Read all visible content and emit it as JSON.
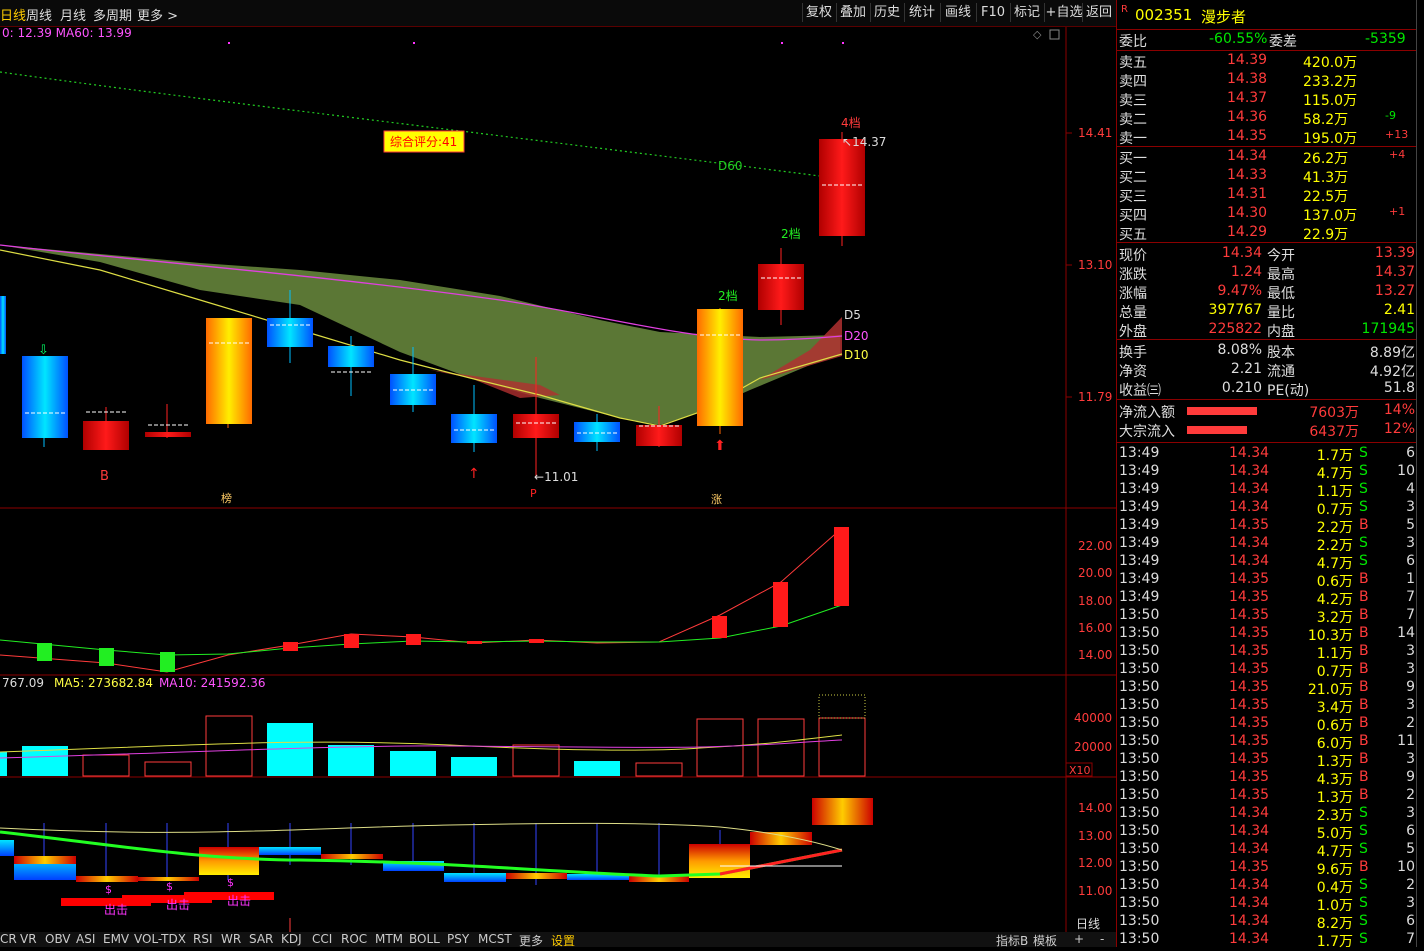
{
  "topbar": {
    "tabs": [
      "日线",
      "周线",
      "月线",
      "多周期",
      "更多 >"
    ],
    "buttons": [
      "复权",
      "叠加",
      "历史",
      "统计",
      "画线",
      "F10",
      "标记",
      "+自选",
      "返回"
    ]
  },
  "main": {
    "ma_text": "0: 12.39  MA60: 13.99",
    "score": "综合评分:41",
    "d60": "D60",
    "d5": "D5",
    "d20": "D20",
    "d10": "D10",
    "price_labels": [
      "14.41",
      "13.10",
      "11.79"
    ],
    "high_mark": "14.37",
    "low_mark": "11.01",
    "tag_4": "4档",
    "tag_2a": "2档",
    "tag_2b": "2档",
    "mark_b": "B",
    "mark_bang": "榜",
    "mark_zhang": "涨"
  },
  "panel2": {
    "axis": [
      "22.00",
      "20.00",
      "18.00",
      "16.00",
      "14.00"
    ]
  },
  "volume": {
    "text_a": "767.09",
    "text_b": "MA5: 273682.84",
    "text_c": "MA10: 241592.36",
    "axis": [
      "40000",
      "20000"
    ],
    "unit": "X10"
  },
  "panel4": {
    "axis": [
      "14.00",
      "13.00",
      "12.00",
      "11.00"
    ],
    "label_chuji": "出击",
    "dollar": "$"
  },
  "bottom": {
    "tabs": [
      "CR",
      "VR",
      "OBV",
      "ASI",
      "EMV",
      "VOL-TDX",
      "RSI",
      "WR",
      "SAR",
      "KDJ",
      "CCI",
      "ROC",
      "MTM",
      "BOLL",
      "PSY",
      "MCST",
      "更多",
      "设置"
    ],
    "right": [
      "指标B",
      "模板",
      "+",
      "-"
    ],
    "period": "日线"
  },
  "quote": {
    "code": "002351",
    "name": "漫步者",
    "r_mark": "R",
    "weibi_label": "委比",
    "weibi": "-60.55%",
    "weicha_label": "委差",
    "weicha": "-5359",
    "sell": [
      {
        "label": "卖五",
        "price": "14.39",
        "vol": "420.0万",
        "chg": ""
      },
      {
        "label": "卖四",
        "price": "14.38",
        "vol": "233.2万",
        "chg": ""
      },
      {
        "label": "卖三",
        "price": "14.37",
        "vol": "115.0万",
        "chg": ""
      },
      {
        "label": "卖二",
        "price": "14.36",
        "vol": "58.2万",
        "chg": "-9"
      },
      {
        "label": "卖一",
        "price": "14.35",
        "vol": "195.0万",
        "chg": "+13"
      }
    ],
    "buy": [
      {
        "label": "买一",
        "price": "14.34",
        "vol": "26.2万",
        "chg": "+4"
      },
      {
        "label": "买二",
        "price": "14.33",
        "vol": "41.3万",
        "chg": ""
      },
      {
        "label": "买三",
        "price": "14.31",
        "vol": "22.5万",
        "chg": ""
      },
      {
        "label": "买四",
        "price": "14.30",
        "vol": "137.0万",
        "chg": "+1"
      },
      {
        "label": "买五",
        "price": "14.29",
        "vol": "22.9万",
        "chg": ""
      }
    ],
    "stats": [
      {
        "l1": "现价",
        "v1": "14.34",
        "l2": "今开",
        "v2": "13.39"
      },
      {
        "l1": "涨跌",
        "v1": "1.24",
        "l2": "最高",
        "v2": "14.37"
      },
      {
        "l1": "涨幅",
        "v1": "9.47%",
        "l2": "最低",
        "v2": "13.27"
      },
      {
        "l1": "总量",
        "v1": "397767",
        "l2": "量比",
        "v2": "2.41"
      },
      {
        "l1": "外盘",
        "v1": "225822",
        "l2": "内盘",
        "v2": "171945"
      }
    ],
    "stats2": [
      {
        "l1": "换手",
        "v1": "8.08%",
        "l2": "股本",
        "v2": "8.89亿"
      },
      {
        "l1": "净资",
        "v1": "2.21",
        "l2": "流通",
        "v2": "4.92亿"
      },
      {
        "l1": "收益㈢",
        "v1": "0.210",
        "l2": "PE(动)",
        "v2": "51.8"
      }
    ],
    "flow": [
      {
        "label": "净流入额",
        "value": "7603万",
        "pct": "14%"
      },
      {
        "label": "大宗流入",
        "value": "6437万",
        "pct": "12%"
      }
    ],
    "ticks": [
      [
        "13:49",
        "14.34",
        "1.7万",
        "S",
        "6"
      ],
      [
        "13:49",
        "14.34",
        "4.7万",
        "S",
        "10"
      ],
      [
        "13:49",
        "14.34",
        "1.1万",
        "S",
        "4"
      ],
      [
        "13:49",
        "14.34",
        "0.7万",
        "S",
        "3"
      ],
      [
        "13:49",
        "14.35",
        "2.2万",
        "B",
        "5"
      ],
      [
        "13:49",
        "14.34",
        "2.2万",
        "S",
        "3"
      ],
      [
        "13:49",
        "14.34",
        "4.7万",
        "S",
        "6"
      ],
      [
        "13:49",
        "14.35",
        "0.6万",
        "B",
        "1"
      ],
      [
        "13:49",
        "14.35",
        "4.2万",
        "B",
        "7"
      ],
      [
        "13:50",
        "14.35",
        "3.2万",
        "B",
        "7"
      ],
      [
        "13:50",
        "14.35",
        "10.3万",
        "B",
        "14"
      ],
      [
        "13:50",
        "14.35",
        "1.1万",
        "B",
        "3"
      ],
      [
        "13:50",
        "14.35",
        "0.7万",
        "B",
        "3"
      ],
      [
        "13:50",
        "14.35",
        "21.0万",
        "B",
        "9"
      ],
      [
        "13:50",
        "14.35",
        "3.4万",
        "B",
        "3"
      ],
      [
        "13:50",
        "14.35",
        "0.6万",
        "B",
        "2"
      ],
      [
        "13:50",
        "14.35",
        "6.0万",
        "B",
        "11"
      ],
      [
        "13:50",
        "14.35",
        "1.3万",
        "B",
        "3"
      ],
      [
        "13:50",
        "14.35",
        "4.3万",
        "B",
        "9"
      ],
      [
        "13:50",
        "14.35",
        "1.3万",
        "B",
        "2"
      ],
      [
        "13:50",
        "14.34",
        "2.3万",
        "S",
        "3"
      ],
      [
        "13:50",
        "14.34",
        "5.0万",
        "S",
        "6"
      ],
      [
        "13:50",
        "14.34",
        "4.7万",
        "S",
        "5"
      ],
      [
        "13:50",
        "14.35",
        "9.6万",
        "B",
        "10"
      ],
      [
        "13:50",
        "14.34",
        "0.4万",
        "S",
        "2"
      ],
      [
        "13:50",
        "14.34",
        "1.0万",
        "S",
        "3"
      ],
      [
        "13:50",
        "14.34",
        "8.2万",
        "S",
        "6"
      ],
      [
        "13:50",
        "14.34",
        "1.7万",
        "S",
        "7"
      ]
    ]
  }
}
